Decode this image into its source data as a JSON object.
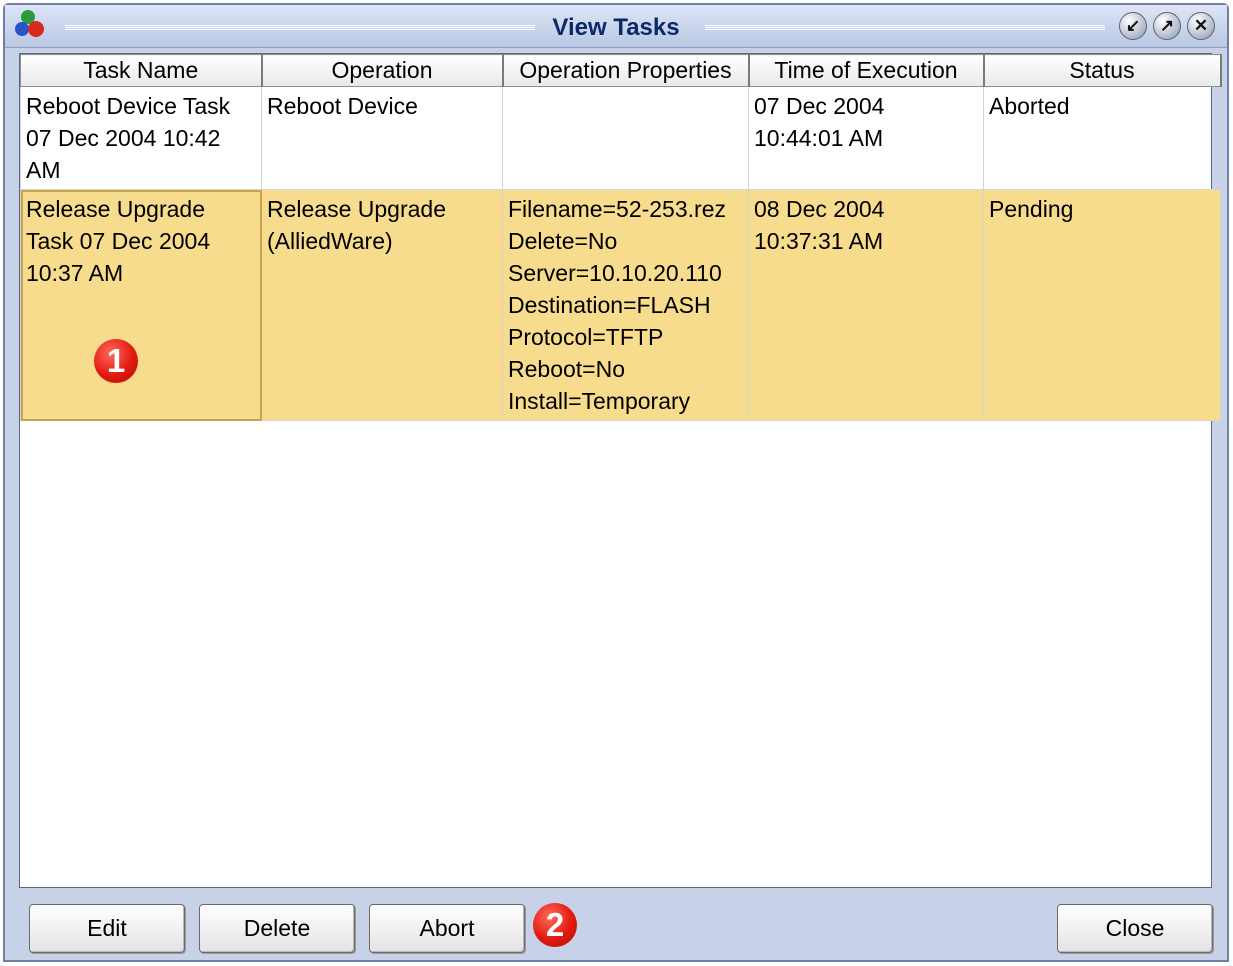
{
  "window": {
    "title": "View Tasks"
  },
  "table": {
    "columns": [
      "Task Name",
      "Operation",
      "Operation Properties",
      "Time of Execution",
      "Status"
    ],
    "rows": [
      {
        "task_name": "Reboot Device Task\n07 Dec 2004 10:42\nAM",
        "operation": "Reboot Device",
        "properties": "",
        "time": "07 Dec 2004\n10:44:01 AM",
        "status": "Aborted"
      },
      {
        "task_name": "Release Upgrade\nTask 07  Dec 2004\n10:37 AM",
        "operation": "Release Upgrade\n(AlliedWare)",
        "properties": "Filename=52-253.rez\nDelete=No\nServer=10.10.20.110\nDestination=FLASH\nProtocol=TFTP\nReboot=No\nInstall=Temporary",
        "time": "08 Dec 2004\n10:37:31 AM",
        "status": "Pending"
      }
    ]
  },
  "buttons": {
    "edit": "Edit",
    "delete": "Delete",
    "abort": "Abort",
    "close": "Close"
  },
  "callouts": [
    "1",
    "2"
  ],
  "colors": {
    "selected_row": "#f8dc8e",
    "callout": "#e21a10",
    "title_text": "#0a2a6a"
  }
}
